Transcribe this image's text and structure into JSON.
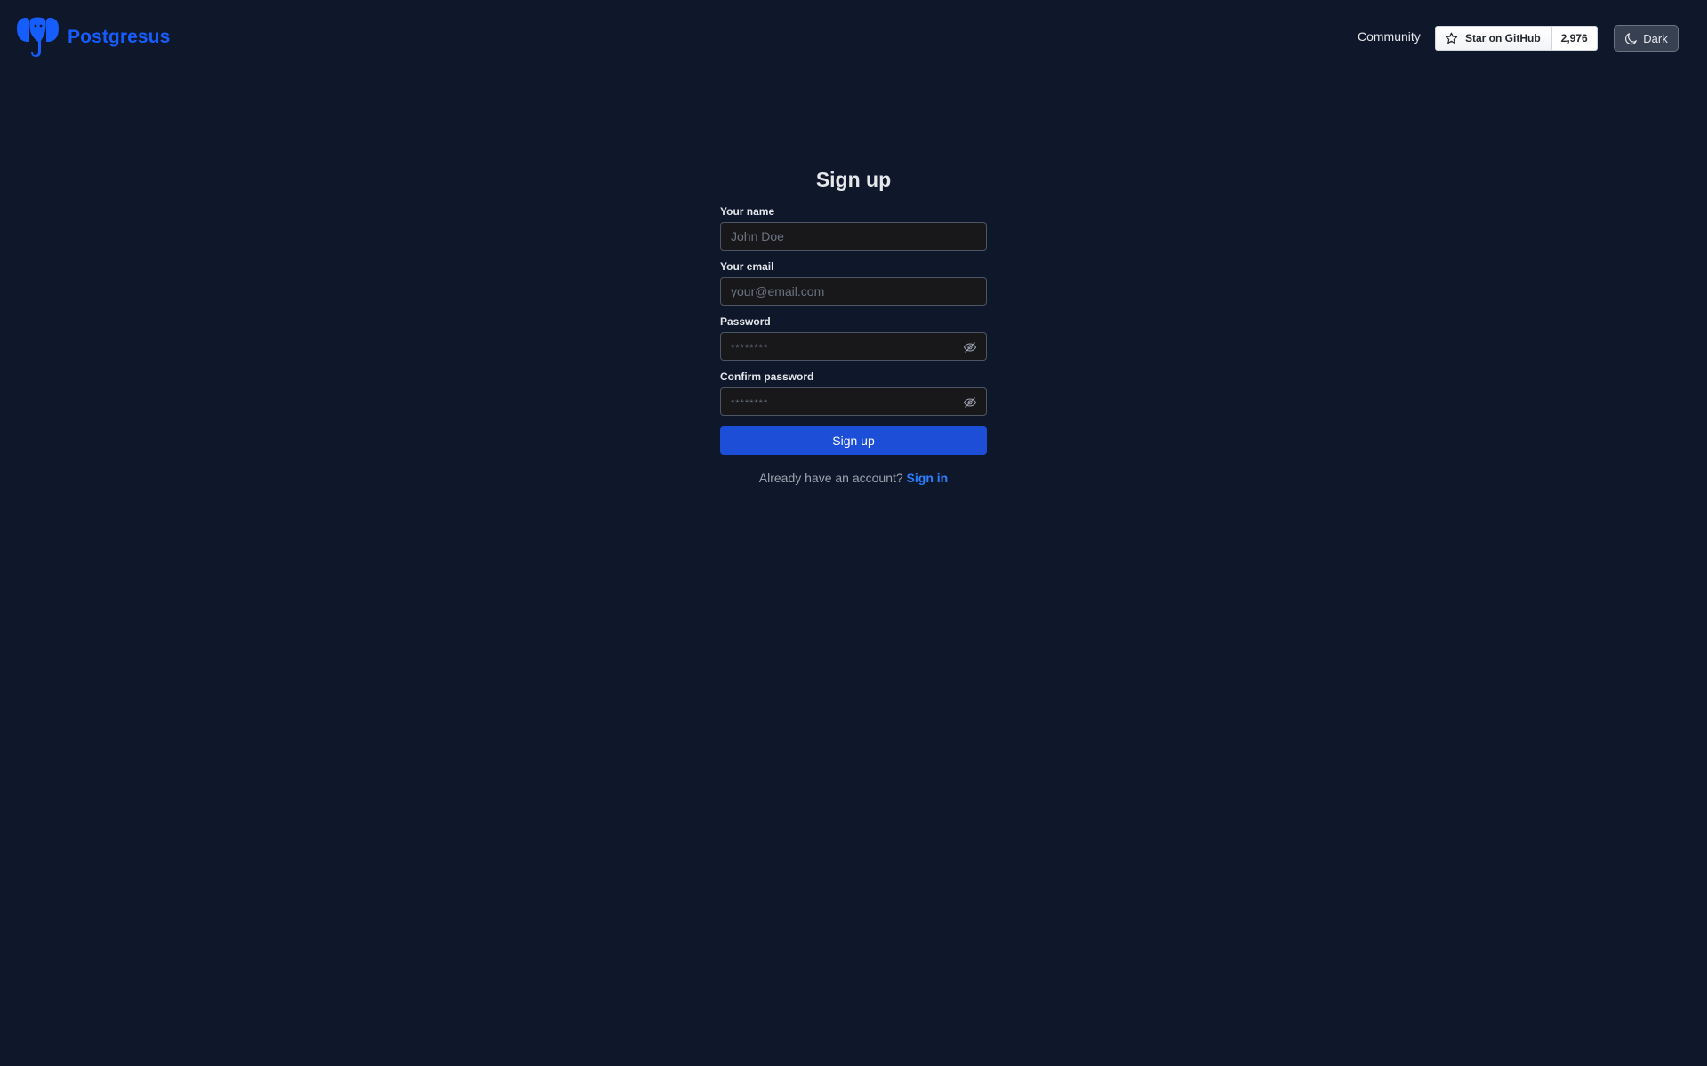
{
  "brand": {
    "name": "Postgresus",
    "color": "#155dfc"
  },
  "nav": {
    "community_label": "Community",
    "github_star_label": "Star on GitHub",
    "github_star_count": "2,976",
    "theme_label": "Dark"
  },
  "form": {
    "title": "Sign up",
    "fields": [
      {
        "label": "Your name",
        "placeholder": "John Doe",
        "value": ""
      },
      {
        "label": "Your email",
        "placeholder": "your@email.com",
        "value": ""
      },
      {
        "label": "Password",
        "placeholder": "********",
        "value": ""
      },
      {
        "label": "Confirm password",
        "placeholder": "********",
        "value": ""
      }
    ],
    "submit_label": "Sign up",
    "alt_prompt": "Already have an account?",
    "alt_link_label": "Sign in"
  },
  "colors": {
    "background": "#0f172a",
    "primary_button": "#1d4ed8",
    "link": "#2b7fff"
  },
  "icons": {
    "logo": "elephant-logo-icon",
    "star": "star-icon",
    "theme": "moon-icon",
    "password_toggle": "eye-off-icon"
  }
}
